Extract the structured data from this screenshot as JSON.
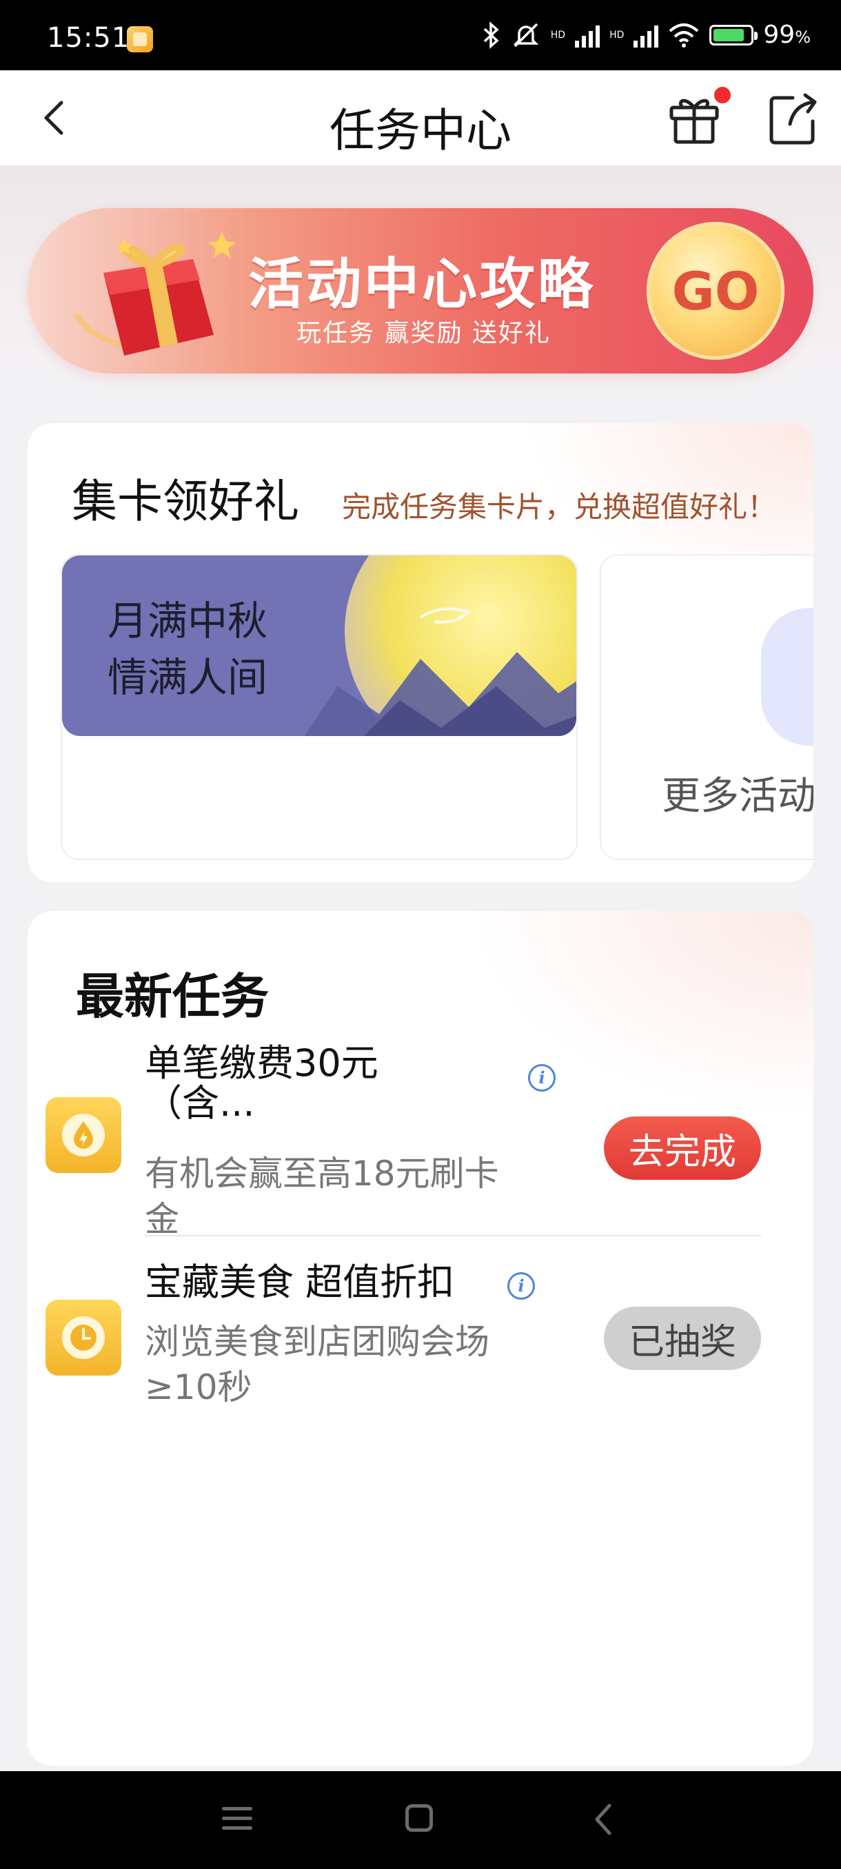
{
  "status_bar": {
    "time": "15:51",
    "battery_pct": "99",
    "battery_unit": "%",
    "hd_label": "HD"
  },
  "header": {
    "title": "任务中心"
  },
  "banner": {
    "title": "活动中心攻略",
    "subtitle": "玩任务 赢奖励 送好礼",
    "go_label": "GO"
  },
  "collect": {
    "title": "集卡领好礼",
    "subtitle": "完成任务集卡片，兑换超值好礼！",
    "activity_line1": "月满中秋",
    "activity_line2": "情满人间",
    "more_label": "更多活动"
  },
  "tasks": {
    "title": "最新任务",
    "items": [
      {
        "name_line1": "单笔缴费30元",
        "name_line2": "（含...",
        "desc": "有机会赢至高18元刷卡金",
        "button": "去完成",
        "info": "i"
      },
      {
        "name_line1": "宝藏美食 超值折扣",
        "desc": "浏览美食到店团购会场≥10秒",
        "button": "已抽奖",
        "info": "i"
      }
    ]
  },
  "colors": {
    "accent_red": "#e13a36",
    "icon_yellow": "#f4b42a",
    "subtitle_brown": "#a0522d"
  }
}
